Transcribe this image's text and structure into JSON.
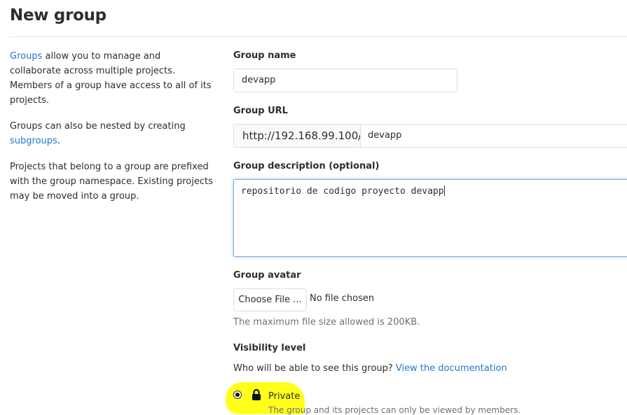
{
  "page": {
    "title": "New group"
  },
  "sidebar": {
    "p1_link": "Groups",
    "p1_text": " allow you to manage and collaborate across multiple projects. Members of a group have access to all of its projects.",
    "p2_text": "Groups can also be nested by creating ",
    "p2_link": "subgroups",
    "p2_end": ".",
    "p3_text": "Projects that belong to a group are prefixed with the group namespace. Existing projects may be moved into a group."
  },
  "form": {
    "name_label": "Group name",
    "name_value": "devapp",
    "url_label": "Group URL",
    "url_prefix": "http://192.168.99.100/",
    "url_path": "devapp",
    "description_label": "Group description (optional)",
    "description_value": "repositorio de codigo proyecto devapp",
    "avatar_label": "Group avatar",
    "choose_file_label": "Choose File ...",
    "file_status": "No file chosen",
    "file_help": "The maximum file size allowed is 200KB.",
    "visibility_label": "Visibility level",
    "visibility_question": "Who will be able to see this group? ",
    "visibility_doc_link": "View the documentation",
    "private_label": "Private",
    "private_desc_partial": "The group and its projects can only be viewed by members."
  },
  "colors": {
    "link": "#1f78d1",
    "highlight": "#ffff1a",
    "focus_border": "#73afea"
  }
}
